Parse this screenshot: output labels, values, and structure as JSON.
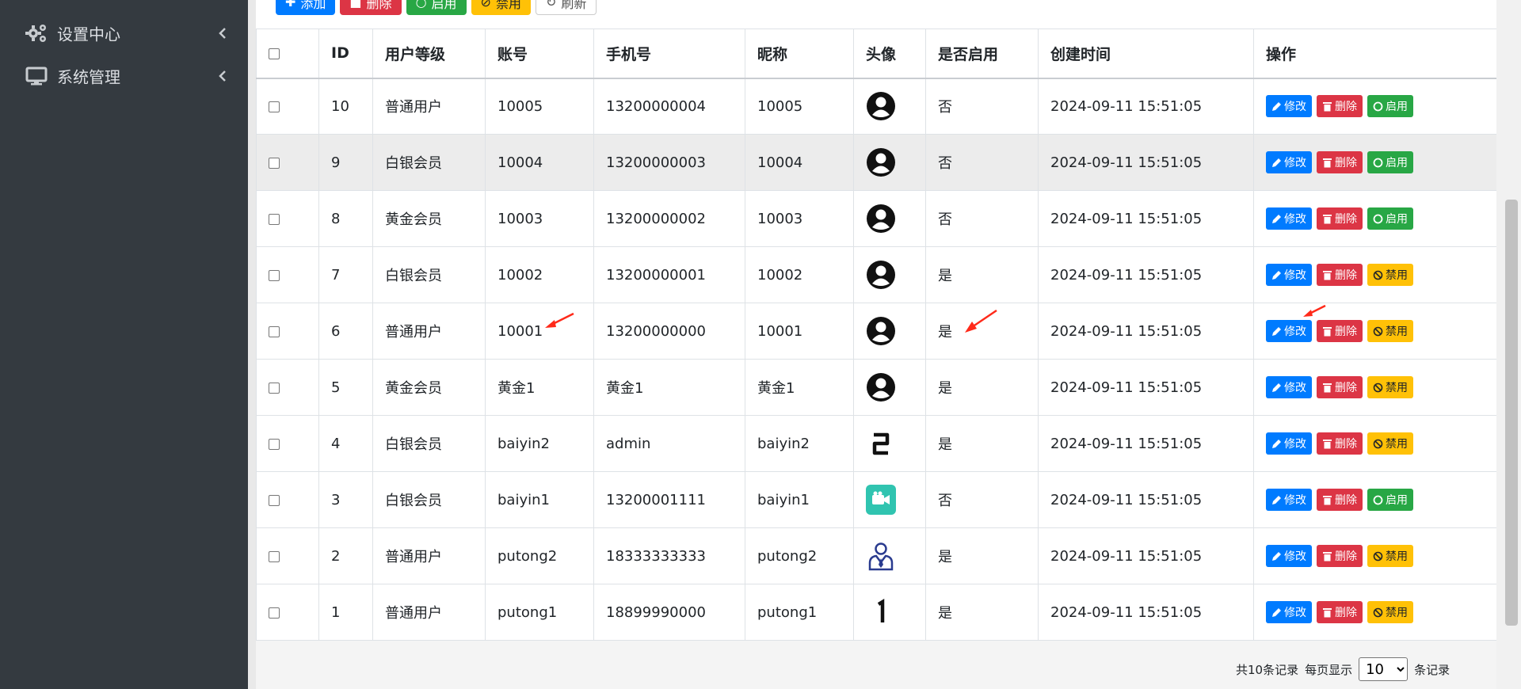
{
  "sidebar": {
    "items": [
      {
        "label": "设置中心",
        "icon": "gears-icon"
      },
      {
        "label": "系统管理",
        "icon": "monitor-icon"
      }
    ]
  },
  "toolbar": {
    "add": "添加",
    "delete": "删除",
    "enable": "启用",
    "disable": "禁用",
    "refresh": "刷新"
  },
  "table": {
    "headers": {
      "id": "ID",
      "level": "用户等级",
      "account": "账号",
      "phone": "手机号",
      "nickname": "昵称",
      "avatar": "头像",
      "enabled": "是否启用",
      "created": "创建时间",
      "actions": "操作"
    },
    "action_labels": {
      "edit": "修改",
      "delete": "删除",
      "enable": "启用",
      "disable": "禁用"
    },
    "rows": [
      {
        "id": "10",
        "level": "普通用户",
        "account": "10005",
        "phone": "13200000004",
        "nickname": "10005",
        "avatar": "user-avatar-icon",
        "enabled": "否",
        "created": "2024-09-11 15:51:05"
      },
      {
        "id": "9",
        "level": "白银会员",
        "account": "10004",
        "phone": "13200000003",
        "nickname": "10004",
        "avatar": "user-avatar-icon",
        "enabled": "否",
        "created": "2024-09-11 15:51:05"
      },
      {
        "id": "8",
        "level": "黄金会员",
        "account": "10003",
        "phone": "13200000002",
        "nickname": "10003",
        "avatar": "user-avatar-icon",
        "enabled": "否",
        "created": "2024-09-11 15:51:05"
      },
      {
        "id": "7",
        "level": "白银会员",
        "account": "10002",
        "phone": "13200000001",
        "nickname": "10002",
        "avatar": "user-avatar-icon",
        "enabled": "是",
        "created": "2024-09-11 15:51:05"
      },
      {
        "id": "6",
        "level": "普通用户",
        "account": "10001",
        "phone": "13200000000",
        "nickname": "10001",
        "avatar": "user-avatar-icon",
        "enabled": "是",
        "created": "2024-09-11 15:51:05"
      },
      {
        "id": "5",
        "level": "黄金会员",
        "account": "黄金1",
        "phone": "黄金1",
        "nickname": "黄金1",
        "avatar": "user-avatar-icon",
        "enabled": "是",
        "created": "2024-09-11 15:51:05"
      },
      {
        "id": "4",
        "level": "白银会员",
        "account": "baiyin2",
        "phone": "admin",
        "nickname": "baiyin2",
        "avatar": "digit-2-icon",
        "enabled": "是",
        "created": "2024-09-11 15:51:05"
      },
      {
        "id": "3",
        "level": "白银会员",
        "account": "baiyin1",
        "phone": "13200001111",
        "nickname": "baiyin1",
        "avatar": "video-camera-icon",
        "enabled": "否",
        "created": "2024-09-11 15:51:05"
      },
      {
        "id": "2",
        "level": "普通用户",
        "account": "putong2",
        "phone": "18333333333",
        "nickname": "putong2",
        "avatar": "business-person-icon",
        "enabled": "是",
        "created": "2024-09-11 15:51:05"
      },
      {
        "id": "1",
        "level": "普通用户",
        "account": "putong1",
        "phone": "18899990000",
        "nickname": "putong1",
        "avatar": "digit-1-icon",
        "enabled": "是",
        "created": "2024-09-11 15:51:05"
      }
    ]
  },
  "pager": {
    "total": "共10条记录",
    "per_page_label": "每页显示",
    "per_page_value": "10",
    "suffix": "条记录"
  },
  "colors": {
    "sidebar": "#343a40",
    "primary": "#007bff",
    "danger": "#dc3545",
    "success": "#28a745",
    "warning": "#ffc107",
    "annotation": "#ff2a1a"
  }
}
